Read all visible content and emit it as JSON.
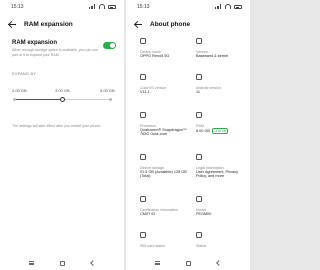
{
  "ram_screen": {
    "status_time": "15:13",
    "title": "RAM expansion",
    "setting_title": "RAM expansion",
    "setting_desc": "When enough storage space is available, you can use part of it to expand your RAM",
    "toggle_on": true,
    "expand_label": "EXPAND BY",
    "sizes": [
      "2.00 GB",
      "3.00 GB",
      "5.00 GB"
    ],
    "selected_size_index": 1,
    "note": "The settings will take effect after you restart your phone.",
    "accent_color": "#2fa94e"
  },
  "about_screen": {
    "status_time": "15:13",
    "title": "About phone",
    "items": [
      {
        "icon": "phone-icon",
        "label": "Device name",
        "value": "OPPO Reno5 5G",
        "badge": ""
      },
      {
        "icon": "version-icon",
        "label": "Version",
        "value": "Baseband & kernel",
        "badge": ""
      },
      {
        "icon": "coloros-icon",
        "label": "ColorOS version",
        "value": "V11.1",
        "badge": ""
      },
      {
        "icon": "android-icon",
        "label": "Android version",
        "value": "11",
        "badge": ""
      },
      {
        "icon": "processor-icon",
        "label": "Processor",
        "value": "Qualcomm® Snapdragon™ 765G Octa-core",
        "badge": ""
      },
      {
        "icon": "ram-icon",
        "label": "RAM",
        "value": "8.00 GB",
        "badge": "+3.00 GB"
      },
      {
        "icon": "storage-icon",
        "label": "Device storage",
        "value": "91.4 GB (Available) 128 GB (Total)",
        "badge": ""
      },
      {
        "icon": "legal-icon",
        "label": "Legal information",
        "value": "User Agreement, Privacy Policy, and more",
        "badge": ""
      },
      {
        "icon": "certificate-icon",
        "label": "Certification information",
        "value": "CMIIT ID",
        "badge": ""
      },
      {
        "icon": "model-icon",
        "label": "Model",
        "value": "PEGM00",
        "badge": ""
      },
      {
        "icon": "sim-icon",
        "label": "SIM card status",
        "value": "",
        "badge": ""
      },
      {
        "icon": "status-icon",
        "label": "Status",
        "value": "",
        "badge": ""
      }
    ]
  }
}
